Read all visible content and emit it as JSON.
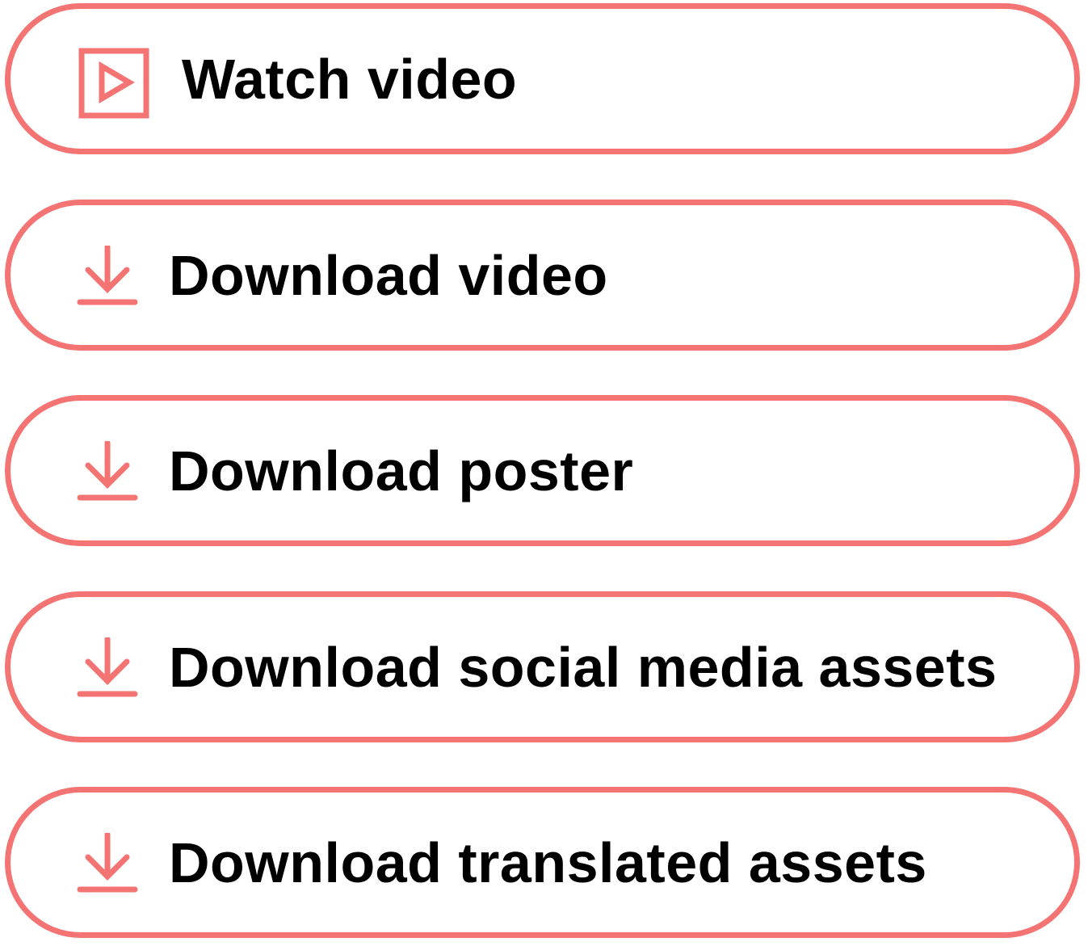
{
  "colors": {
    "accent": "#f47373",
    "text": "#000000",
    "background": "#ffffff"
  },
  "buttons": [
    {
      "label": "Watch video",
      "icon": "play-icon"
    },
    {
      "label": "Download video",
      "icon": "download-icon"
    },
    {
      "label": "Download poster",
      "icon": "download-icon"
    },
    {
      "label": "Download social media assets",
      "icon": "download-icon"
    },
    {
      "label": "Download translated assets",
      "icon": "download-icon"
    }
  ]
}
